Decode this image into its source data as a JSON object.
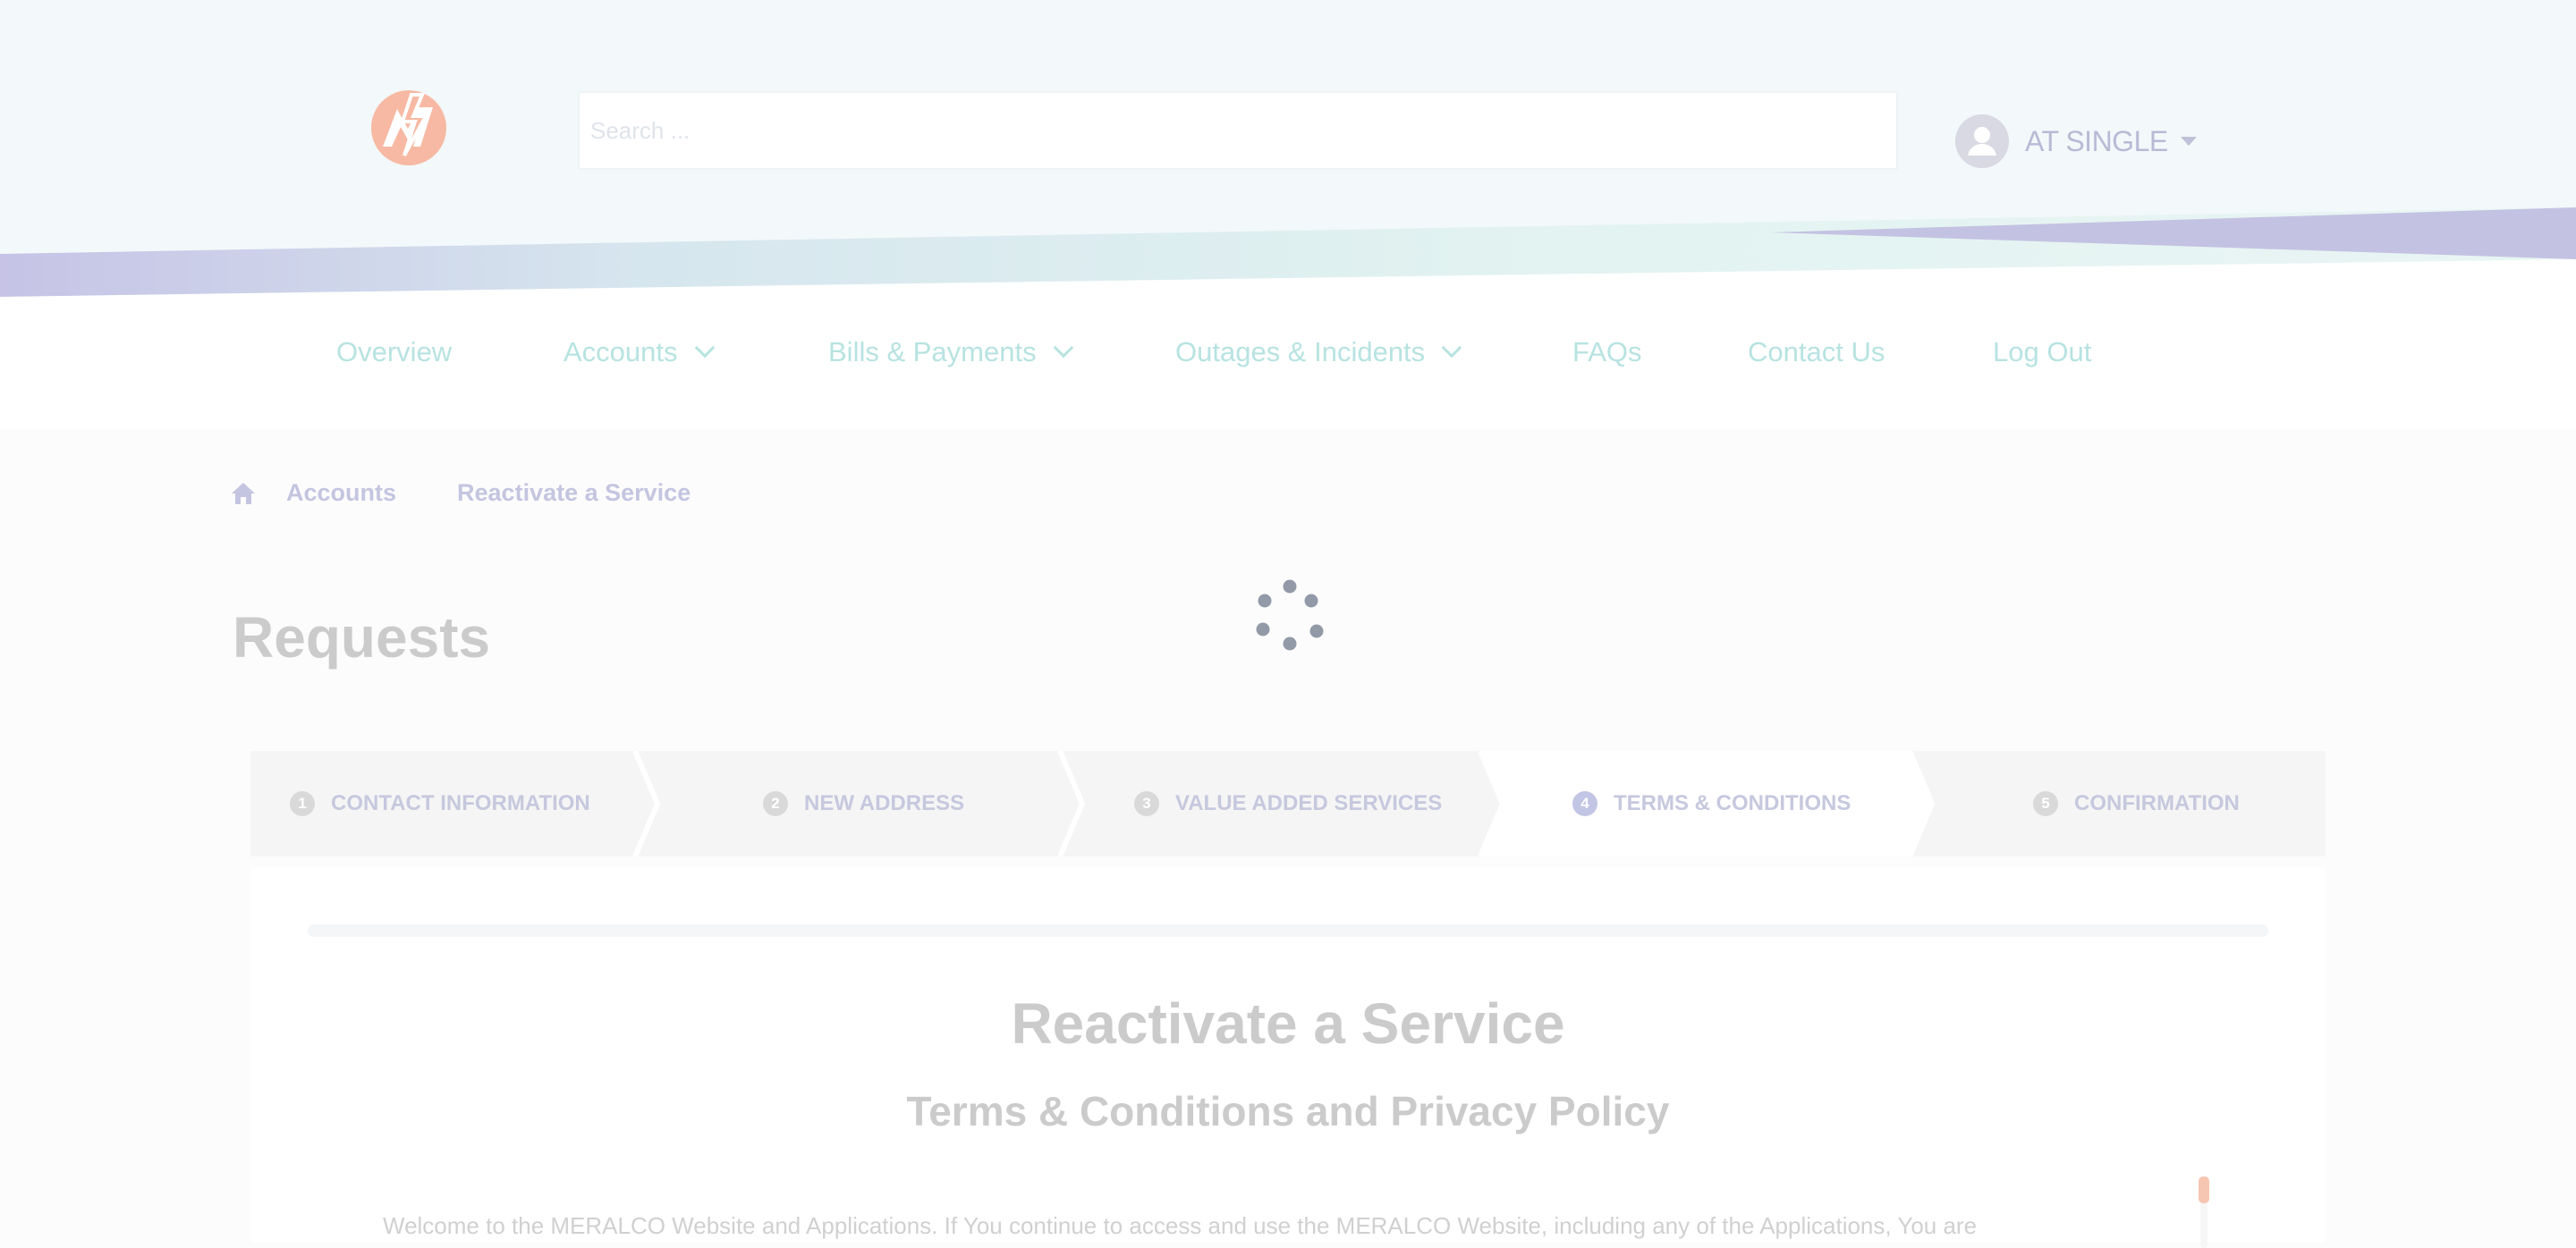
{
  "header": {
    "search_placeholder": "Search ...",
    "user_name": "AT SINGLE"
  },
  "nav": {
    "items": [
      {
        "label": "Overview",
        "has_dropdown": false
      },
      {
        "label": "Accounts",
        "has_dropdown": true
      },
      {
        "label": "Bills & Payments",
        "has_dropdown": true
      },
      {
        "label": "Outages & Incidents",
        "has_dropdown": true
      },
      {
        "label": "FAQs",
        "has_dropdown": false
      },
      {
        "label": "Contact Us",
        "has_dropdown": false
      },
      {
        "label": "Log Out",
        "has_dropdown": false
      }
    ]
  },
  "breadcrumb": {
    "items": [
      "Accounts",
      "Reactivate a Service"
    ]
  },
  "page": {
    "title": "Requests"
  },
  "stepper": {
    "active_step": 4,
    "steps": [
      {
        "num": "1",
        "label": "CONTACT INFORMATION"
      },
      {
        "num": "2",
        "label": "NEW ADDRESS"
      },
      {
        "num": "3",
        "label": "VALUE ADDED SERVICES"
      },
      {
        "num": "4",
        "label": "TERMS & CONDITIONS"
      },
      {
        "num": "5",
        "label": "CONFIRMATION"
      }
    ]
  },
  "card": {
    "title": "Reactivate a Service",
    "subtitle": "Terms & Conditions and Privacy Policy",
    "body_text": "Welcome to the MERALCO Website and Applications. If You continue to access and use the MERALCO Website, including any of the Applications, You are"
  },
  "colors": {
    "brand_orange": "#f7b9a3",
    "nav_teal": "#b7e3e1",
    "accent_lavender": "#c4c5e0",
    "muted_title": "#cbcbcb"
  },
  "icons": {
    "logo": "meralco-logo",
    "home": "home-icon",
    "user": "user-avatar-icon",
    "loading": "loading-spinner-icon"
  }
}
